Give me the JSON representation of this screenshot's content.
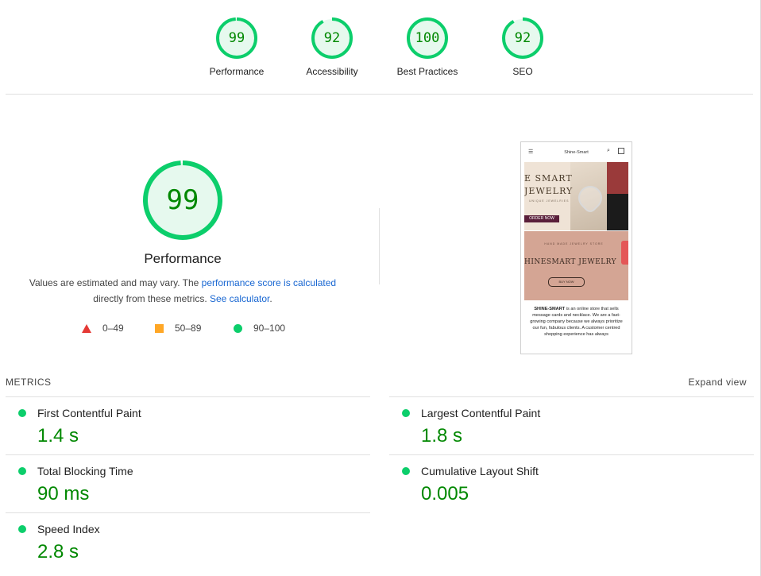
{
  "categories": [
    {
      "label": "Performance",
      "score": "99",
      "fraction": 0.99
    },
    {
      "label": "Accessibility",
      "score": "92",
      "fraction": 0.92
    },
    {
      "label": "Best Practices",
      "score": "100",
      "fraction": 1.0
    },
    {
      "label": "SEO",
      "score": "92",
      "fraction": 0.92
    }
  ],
  "main": {
    "score": "99",
    "fraction": 0.99,
    "title": "Performance",
    "desc_part1": "Values are estimated and may vary. The ",
    "desc_link1": "performance score is calculated",
    "desc_part2": "directly from these metrics. ",
    "desc_link2": "See calculator",
    "desc_end": "."
  },
  "legend": [
    {
      "icon": "fail-triangle-icon",
      "range": "0–49",
      "color": "#e53935"
    },
    {
      "icon": "average-square-icon",
      "range": "50–89",
      "color": "#ffa726"
    },
    {
      "icon": "pass-circle-icon",
      "range": "90–100",
      "color": "#0cce6b"
    }
  ],
  "screenshot": {
    "brand": "Shine-Smart",
    "hero_line1": "E SMART",
    "hero_line2": "JEWELRY",
    "hero_sub": "UNIQUE JEWELRIES",
    "hero_button": "ORDER NOW",
    "banner_small": "HAND MADE JEWELRY STORE",
    "banner_big": "HINESMART JEWELRY",
    "banner_button": "BUY NOW",
    "body_bold": "SHINE-SMART",
    "body_text": " is an online store that sells message cards and necklace. We are a fast-growing company because we always prioritize our fun, fabulous clients. A customer centred shopping experience has always"
  },
  "metrics": {
    "heading": "METRICS",
    "expand_label": "Expand view",
    "items": [
      {
        "name": "First Contentful Paint",
        "value": "1.4 s"
      },
      {
        "name": "Largest Contentful Paint",
        "value": "1.8 s"
      },
      {
        "name": "Total Blocking Time",
        "value": "90 ms"
      },
      {
        "name": "Cumulative Layout Shift",
        "value": "0.005"
      },
      {
        "name": "Speed Index",
        "value": "2.8 s"
      }
    ]
  },
  "colors": {
    "pass": "#0cce6b",
    "pass_text": "#008800",
    "pass_bg": "#e6f9ee",
    "link": "#1967d2"
  }
}
